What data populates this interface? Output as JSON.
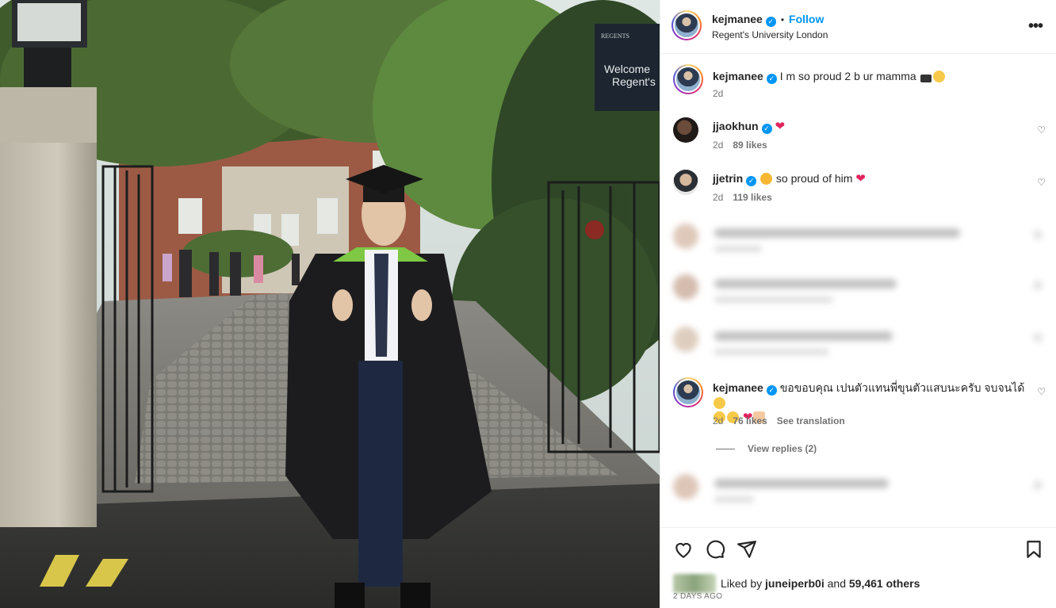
{
  "post": {
    "author": "kejmanee",
    "follow_label": "Follow",
    "location": "Regent's University London",
    "more_label": "•••",
    "sign_text_1": "Welcome",
    "sign_text_2": "Regent's",
    "sign_brand": "REGENTS"
  },
  "caption": {
    "username": "kejmanee",
    "text": "I m so proud 2 b ur mamma",
    "time": "2d"
  },
  "comments": [
    {
      "username": "jjaokhun",
      "text": "",
      "time": "2d",
      "likes": "89 likes"
    },
    {
      "username": "jjetrin",
      "text": "so proud of him",
      "time": "2d",
      "likes": "119 likes"
    },
    {
      "username": "kejmanee",
      "text": "ขอขอบคุณ เปนตัวแทนพี่ขุนตัวแสบนะครับ จบจนได้",
      "time": "2d",
      "likes": "76 likes",
      "translate": "See translation",
      "view_replies": "View replies (2)"
    }
  ],
  "footer": {
    "liked_prefix": "Liked by",
    "liked_user": "juneiperb0i",
    "liked_and": "and",
    "liked_others": "59,461 others",
    "ago": "2 DAYS AGO"
  },
  "icons": {
    "verified": "verified-badge-icon",
    "like": "heart-icon",
    "comment": "comment-icon",
    "share": "send-icon",
    "save": "bookmark-icon"
  },
  "colors": {
    "accent": "#0095f6",
    "heart_red": "#e0245e",
    "muted": "#737373"
  }
}
